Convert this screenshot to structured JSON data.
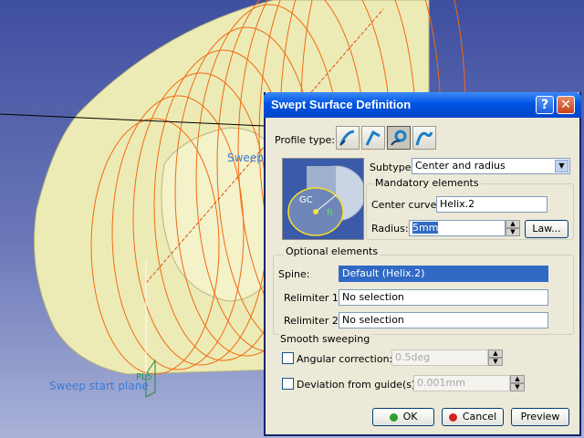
{
  "viewport": {
    "labels": {
      "sweep_start_plane": "Sweep start plane",
      "sweep_partial": "Sweep",
      "plane_tag": "PL5"
    },
    "colors": {
      "surface": "#ecebb5",
      "helix": "#f26a12",
      "background": "#4a5aa8"
    }
  },
  "dialog": {
    "title": "Swept Surface Definition",
    "help_label": "?",
    "close_label": "✕",
    "profile_type_label": "Profile type:",
    "profile_types": [
      {
        "icon": "explicit-profile-icon"
      },
      {
        "icon": "line-profile-icon"
      },
      {
        "icon": "circle-profile-icon",
        "active": true
      },
      {
        "icon": "conic-profile-icon"
      }
    ],
    "subtype_label": "Subtype:",
    "subtype_value": "Center and radius",
    "preview_labels": {
      "gc": "GC",
      "r": "R"
    },
    "mandatory": {
      "title": "Mandatory elements",
      "center_curve_label": "Center curve:",
      "center_curve_value": "Helix.2",
      "radius_label": "Radius:",
      "radius_value": "5mm",
      "law_button": "Law..."
    },
    "optional": {
      "title": "Optional elements",
      "spine_label": "Spine:",
      "spine_value": "Default (Helix.2)",
      "relimiter1_label": "Relimiter 1:",
      "relimiter1_value": "No selection",
      "relimiter2_label": "Relimiter 2:",
      "relimiter2_value": "No selection"
    },
    "smooth": {
      "title": "Smooth sweeping",
      "angular_label": "Angular correction:",
      "angular_value": "0.5deg",
      "deviation_label": "Deviation from guide(s):",
      "deviation_value": "0.001mm"
    },
    "buttons": {
      "ok": "OK",
      "cancel": "Cancel",
      "preview": "Preview"
    }
  }
}
